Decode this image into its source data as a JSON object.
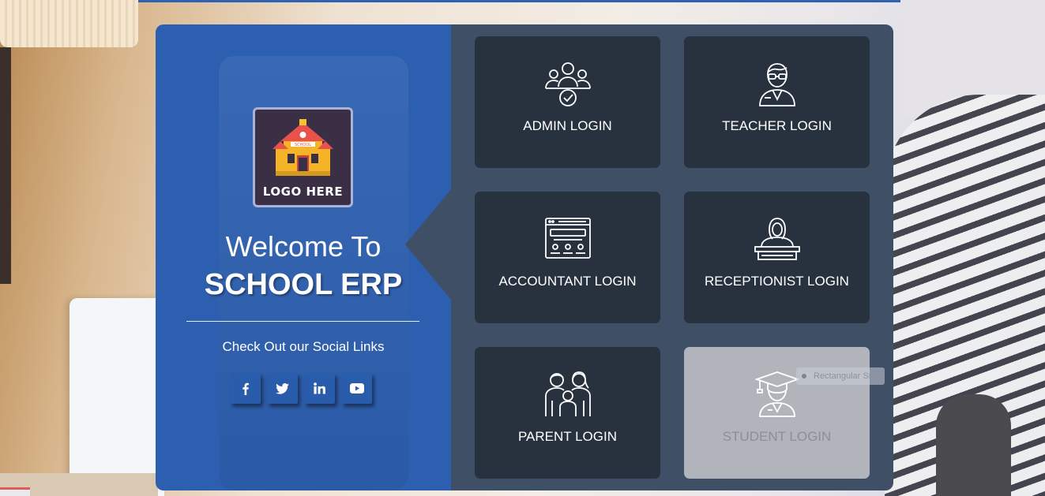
{
  "colors": {
    "brand_blue": "#2d5fb0",
    "panel_dark": "#3f4f66",
    "card_dark": "#28323f",
    "card_disabled": "#b1b4ba"
  },
  "brand": {
    "logo_text": "LOGO HERE",
    "logo_sign": "SCHOOL"
  },
  "welcome": {
    "line1": "Welcome To",
    "line2": "SCHOOL ERP"
  },
  "social": {
    "title": "Check Out our Social Links",
    "links": [
      {
        "icon": "facebook-icon"
      },
      {
        "icon": "twitter-icon"
      },
      {
        "icon": "linkedin-icon"
      },
      {
        "icon": "youtube-icon"
      }
    ]
  },
  "logins": [
    {
      "label": "ADMIN LOGIN",
      "icon": "admin-group-icon"
    },
    {
      "label": "TEACHER LOGIN",
      "icon": "teacher-icon"
    },
    {
      "label": "ACCOUNTANT LOGIN",
      "icon": "accountant-icon"
    },
    {
      "label": "RECEPTIONIST LOGIN",
      "icon": "receptionist-icon"
    },
    {
      "label": "PARENT LOGIN",
      "icon": "parent-family-icon"
    },
    {
      "label": "STUDENT LOGIN",
      "icon": "student-graduate-icon",
      "state": "disabled"
    }
  ],
  "tooltip": {
    "text": "Rectangular Snip"
  }
}
